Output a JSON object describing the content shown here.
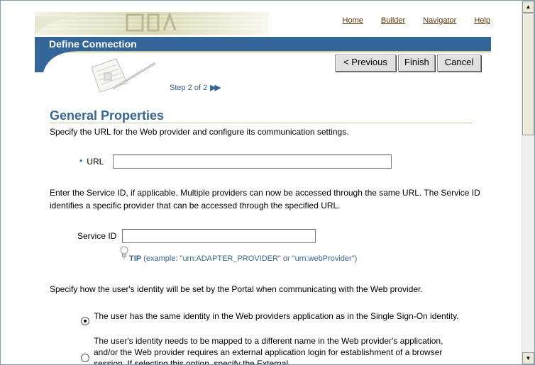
{
  "nav": {
    "home": "Home",
    "builder": "Builder",
    "navigator": "Navigator",
    "help": "Help"
  },
  "header": {
    "title": "Define Connection",
    "step": "Step 2 of 2",
    "step_arrows": "»"
  },
  "buttons": {
    "previous": "< Previous",
    "finish": "Finish",
    "cancel": "Cancel"
  },
  "section": {
    "title": "General Properties",
    "intro": "Specify the URL for the Web provider and configure its communication settings."
  },
  "url": {
    "label": "URL",
    "required_mark": "*",
    "value": ""
  },
  "service": {
    "intro": "Enter the Service ID, if applicable. Multiple providers can now be accessed through the same URL. The Service ID identifies a specific provider that can be accessed through the specified URL.",
    "label": "Service ID",
    "value": "",
    "tip_label": "TIP",
    "tip_text": " (example: \"urn:ADAPTER_PROVIDER\" or \"urn:webProvider\")"
  },
  "identity": {
    "intro": "Specify how the user's identity will be set by the Portal when communicating with the Web provider.",
    "option1": "The user has the same identity in the Web providers application as in the Single Sign-On identity.",
    "option2": "The user's identity needs to be mapped to a different name in the Web provider's application, and/or the Web provider requires an external application login for establishment of a browser session. If selecting this option, specify the External",
    "selected": 1
  },
  "colors": {
    "accent": "#336699",
    "link": "#663300",
    "rule": "#cccc99"
  }
}
